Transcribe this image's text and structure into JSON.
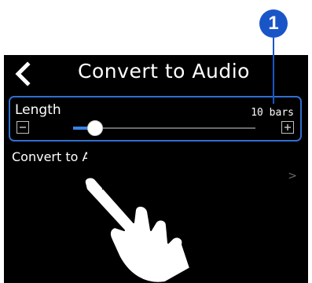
{
  "header": {
    "title": "Convert to Audio",
    "back_icon": "chevron-left-icon"
  },
  "length_setting": {
    "label": "Length",
    "value": "10 bars",
    "decrease_icon": "minus-icon",
    "increase_icon": "plus-icon",
    "slider_level": 0.12
  },
  "convert_row": {
    "label": "Convert to Audio",
    "chevron": ">"
  },
  "callout": {
    "number": "1"
  },
  "colors": {
    "screen_background": "#000000",
    "highlight_border": "#2f6fd0",
    "callout_badge": "#1a55c8",
    "slider_fill": "#3b82e6"
  }
}
